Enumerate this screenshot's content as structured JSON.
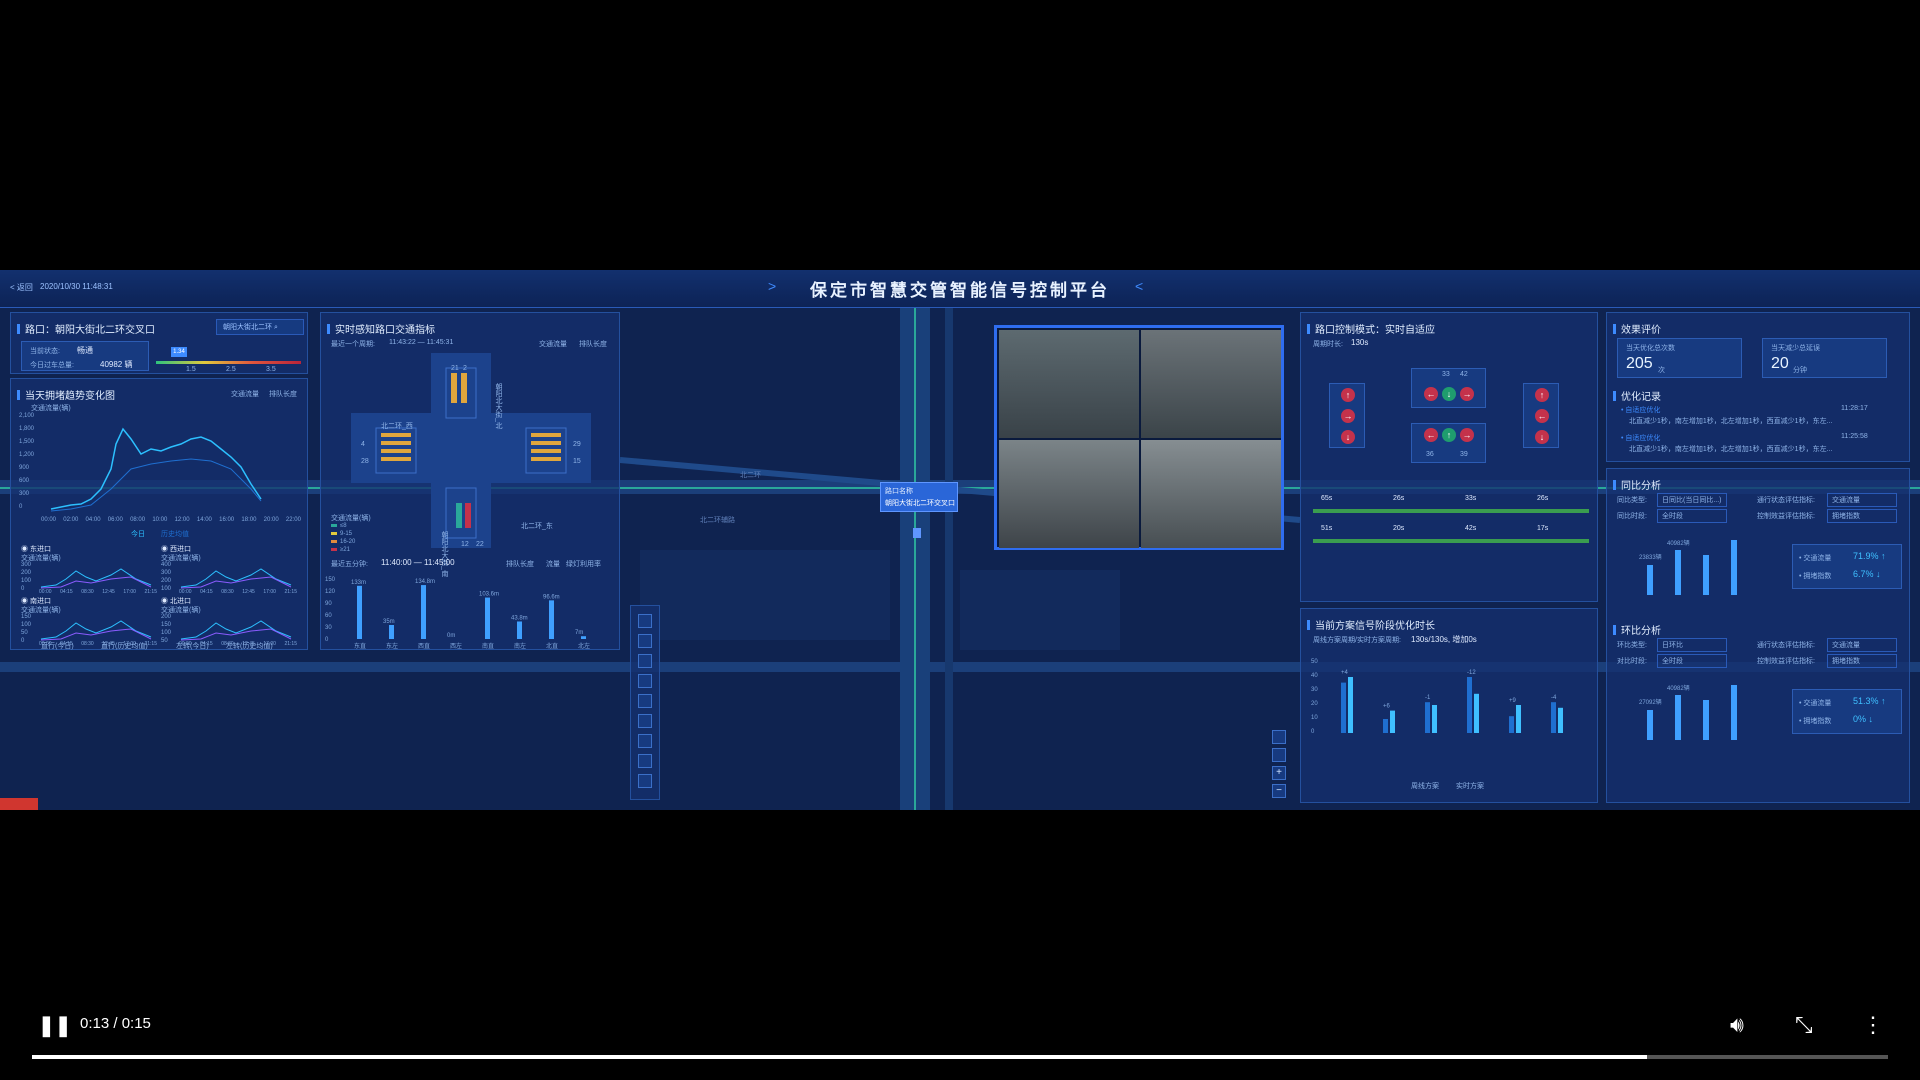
{
  "header": {
    "back": "< 返回",
    "timestamp": "2020/10/30 11:48:31",
    "title": "保定市智慧交管智能信号控制平台"
  },
  "intersection_panel": {
    "label": "路口：朝阳大街北二环交叉口",
    "search_placeholder": "朝阳大街北二环",
    "status_label": "当前状态:",
    "status_value": "畅通",
    "volume_label": "今日过车总量:",
    "volume_value": "40982 辆",
    "index_value": "1.34",
    "scale": [
      "1.5",
      "2.5",
      "3.5"
    ]
  },
  "trend_panel": {
    "title": "当天拥堵趋势变化图",
    "tab1": "交通流量",
    "tab2": "排队长度",
    "ylabel": "交通流量(辆)",
    "yticks": [
      "2,100",
      "1,800",
      "1,500",
      "1,200",
      "900",
      "600",
      "300",
      "0"
    ],
    "xticks": [
      "00:00",
      "02:00",
      "04:00",
      "06:00",
      "08:00",
      "10:00",
      "12:00",
      "14:00",
      "16:00",
      "18:00",
      "20:00",
      "22:00"
    ],
    "legend": [
      "今日",
      "历史均值"
    ]
  },
  "approaches": [
    {
      "name": "东进口",
      "ylabel": "交通流量(辆)",
      "yticks": [
        "300",
        "200",
        "100",
        "0"
      ]
    },
    {
      "name": "西进口",
      "ylabel": "交通流量(辆)",
      "yticks": [
        "400",
        "300",
        "200",
        "100",
        "0"
      ]
    },
    {
      "name": "南进口",
      "ylabel": "交通流量(辆)",
      "yticks": [
        "150",
        "100",
        "50",
        "0"
      ]
    },
    {
      "name": "北进口",
      "ylabel": "交通流量(辆)",
      "yticks": [
        "200",
        "150",
        "100",
        "50",
        "0"
      ]
    }
  ],
  "approach_xticks": [
    "00:00",
    "04:15",
    "08:30",
    "12:45",
    "17:00",
    "21:15"
  ],
  "approach_legend": [
    "直行(今日)",
    "直行(历史均值)",
    "左转(今日)",
    "左转(历史均值)"
  ],
  "realtime_panel": {
    "title": "实时感知路口交通指标",
    "period_label": "最近一个周期:",
    "period_value": "11:43:22 — 11:45:31",
    "tab1": "交通流量",
    "tab2": "排队长度",
    "road_n": "朝阳北大街_北",
    "road_w": "北二环_西",
    "road_e": "北二环_东",
    "road_s": "朝阳北大街_南",
    "n_counts": [
      "21",
      "2"
    ],
    "s_counts": [
      "12",
      "22"
    ],
    "w_counts": [
      "4",
      "28"
    ],
    "e_counts": [
      "29",
      "15"
    ],
    "legend_title": "交通流量(辆)",
    "legend": [
      "≤8",
      "9-15",
      "16-20",
      "≥21"
    ],
    "five_min_label": "最近五分钟:",
    "five_min_value": "11:40:00 — 11:45:00",
    "tabs2": [
      "排队长度",
      "流量",
      "绿灯利用率"
    ],
    "bar_yticks": [
      "150",
      "120",
      "90",
      "60",
      "30",
      "0"
    ],
    "bar_categories": [
      "东直",
      "东左",
      "西直",
      "西左",
      "南直",
      "南左",
      "北直",
      "北左"
    ],
    "bar_labels": [
      "133m",
      "35m",
      "134.8m",
      "0m",
      "103.6m",
      "43.8m",
      "96.6m",
      "7m"
    ]
  },
  "map_labels": {
    "popup_title": "路口名称",
    "popup_name": "朝阳大街北二环交叉口",
    "road1": "北二环",
    "road2": "北二环辅路"
  },
  "control_panel": {
    "title": "路口控制模式：实时自适应",
    "cycle_label": "周期时长:",
    "cycle_value": "130s",
    "signal_numbers": [
      "33",
      "42",
      "36",
      "39"
    ],
    "timing1": [
      "65s",
      "26s",
      "33s",
      "26s"
    ],
    "timing2": [
      "51s",
      "20s",
      "42s",
      "17s"
    ]
  },
  "opt_panel": {
    "title": "当前方案信号阶段优化时长",
    "subtitle": "周线方案周期/实时方案周期:",
    "subtitle_value": "130s/130s, 增加0s",
    "yticks": [
      "50",
      "40",
      "30",
      "20",
      "10",
      "0"
    ],
    "deltas": [
      "+4",
      "+6",
      "-1",
      "-12",
      "+9",
      "-4"
    ],
    "legend": [
      "周线方案",
      "实时方案"
    ]
  },
  "eval_panel": {
    "title": "效果评价",
    "opt_count_label": "当天优化总次数",
    "opt_count_value": "205",
    "opt_count_unit": "次",
    "delay_label": "当天减少总延误",
    "delay_value": "20",
    "delay_unit": "分钟",
    "records_title": "优化记录",
    "records": [
      {
        "title": "自适应优化",
        "time": "11:28:17",
        "text": "北直减少1秒，南左增加1秒，北左增加1秒，西直减少1秒，东左..."
      },
      {
        "title": "自适应优化",
        "time": "11:25:58",
        "text": "北直减少1秒，南左增加1秒，北左增加1秒，西直减少1秒，东左..."
      }
    ]
  },
  "yoy_panel": {
    "title": "同比分析",
    "type_label": "同比类型:",
    "type_value": "日同比(当日同比...)",
    "eval_label": "通行状态评估指标:",
    "eval_value": "交通流量",
    "period_label": "同比时段:",
    "period_value": "全时段",
    "ctrl_label": "控制效益评估指标:",
    "ctrl_value": "拥堵指数",
    "big_labels": [
      "23833辆",
      "40982辆"
    ],
    "metric1_label": "交通流量",
    "metric1_value": "71.9%",
    "metric2_label": "拥堵指数",
    "metric2_value": "6.7%"
  },
  "mom_panel": {
    "title": "环比分析",
    "type_label": "环比类型:",
    "type_value": "日环比",
    "eval_label": "通行状态评估指标:",
    "eval_value": "交通流量",
    "period_label": "对比时段:",
    "period_value": "全时段",
    "ctrl_label": "控制效益评估指标:",
    "ctrl_value": "拥堵指数",
    "big_labels": [
      "27092辆",
      "40982辆"
    ],
    "metric1_label": "交通流量",
    "metric1_value": "51.3%",
    "metric2_label": "拥堵指数",
    "metric2_value": "0%"
  },
  "player": {
    "time": "0:13 / 0:15",
    "progress": 0.87
  },
  "colors": {
    "accent": "#3d8bff",
    "panel": "#14306e",
    "bar": "#3fa0ff"
  }
}
